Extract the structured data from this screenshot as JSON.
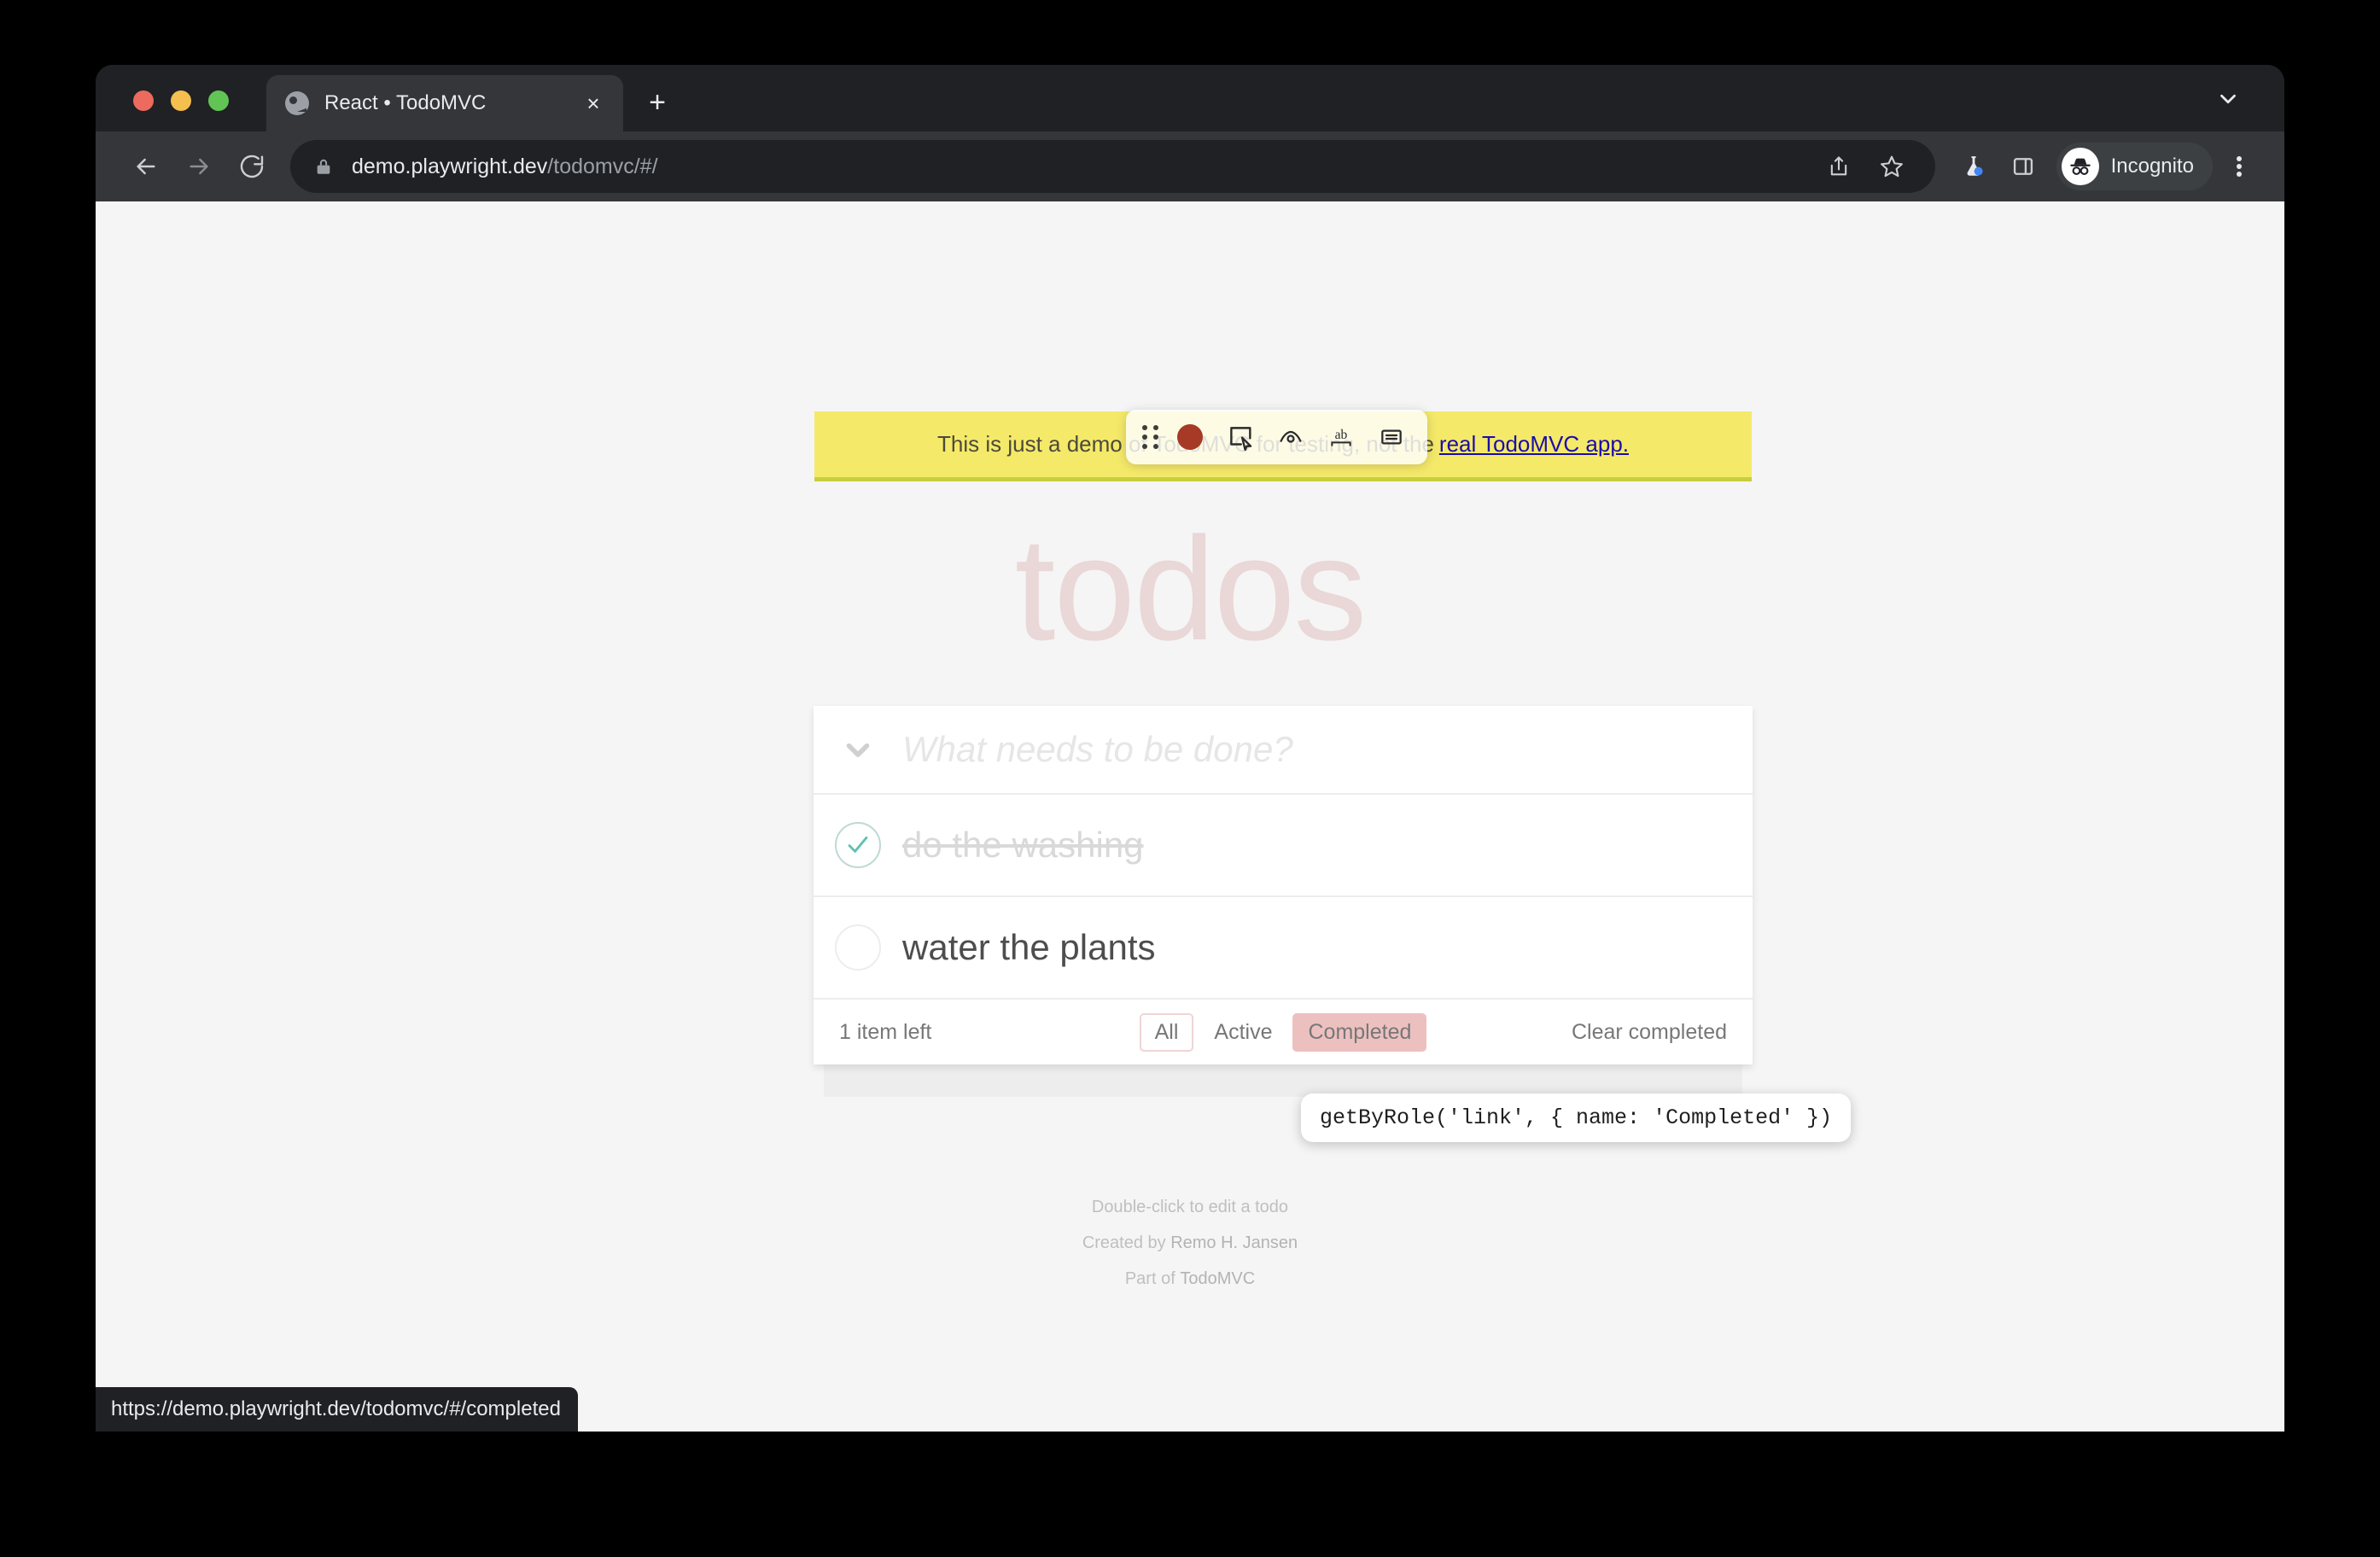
{
  "browser": {
    "tab": {
      "title": "React • TodoMVC",
      "favicon": "globe-icon",
      "close": "×"
    },
    "new_tab_label": "+",
    "tabstrip_chevron": "chevron-down-icon",
    "omnibox": {
      "lock": "lock-icon",
      "url_domain": "demo.playwright.dev",
      "url_path": "/todomvc/#/",
      "share": "share-icon",
      "bookmark": "star-icon"
    },
    "extensions": {
      "flask": "flask-icon",
      "side_panel": "side-panel-icon"
    },
    "profile": {
      "avatar": "incognito-icon",
      "label": "Incognito"
    },
    "menu": "kebab-menu-icon",
    "status_bar_url": "https://demo.playwright.dev/todomvc/#/completed"
  },
  "page": {
    "banner": {
      "text": "This is just a demo of TodoMVC for testing, not the",
      "link": "real TodoMVC app."
    },
    "title": "todos",
    "new_todo": {
      "placeholder": "What needs to be done?",
      "value": "",
      "toggle_all": "chevron-down-icon"
    },
    "todos": [
      {
        "label": "do the washing",
        "completed": true,
        "toggle_icon": "check-icon"
      },
      {
        "label": "water the plants",
        "completed": false,
        "toggle_icon": "empty-circle-icon"
      }
    ],
    "footer": {
      "count": "1 item left",
      "filters": [
        {
          "label": "All",
          "state": "selected"
        },
        {
          "label": "Active",
          "state": "normal"
        },
        {
          "label": "Completed",
          "state": "highlighted"
        }
      ],
      "clear_completed": "Clear completed"
    },
    "info": {
      "line1": "Double-click to edit a todo",
      "line2_prefix": "Created by ",
      "line2_author": "Remo H. Jansen",
      "line3_prefix": "Part of ",
      "line3_project": "TodoMVC"
    }
  },
  "playwright": {
    "toolbar": {
      "drag": "drag-handle-icon",
      "record": "record-icon",
      "pick_locator": "pick-locator-icon",
      "assert_visibility": "eye-icon",
      "assert_text": "ab",
      "assert_value": "assert-value-icon"
    },
    "locator_tooltip": "getByRole('link', { name: 'Completed' })"
  },
  "colors": {
    "chrome_dark": "#202124",
    "chrome_toolbar": "#35363a",
    "banner_yellow": "#f5e96a",
    "todos_pink": "#ead7d7",
    "accent_green": "#5dc2af",
    "highlight_pink": "#de8c8c",
    "record_red": "#a63a26"
  }
}
